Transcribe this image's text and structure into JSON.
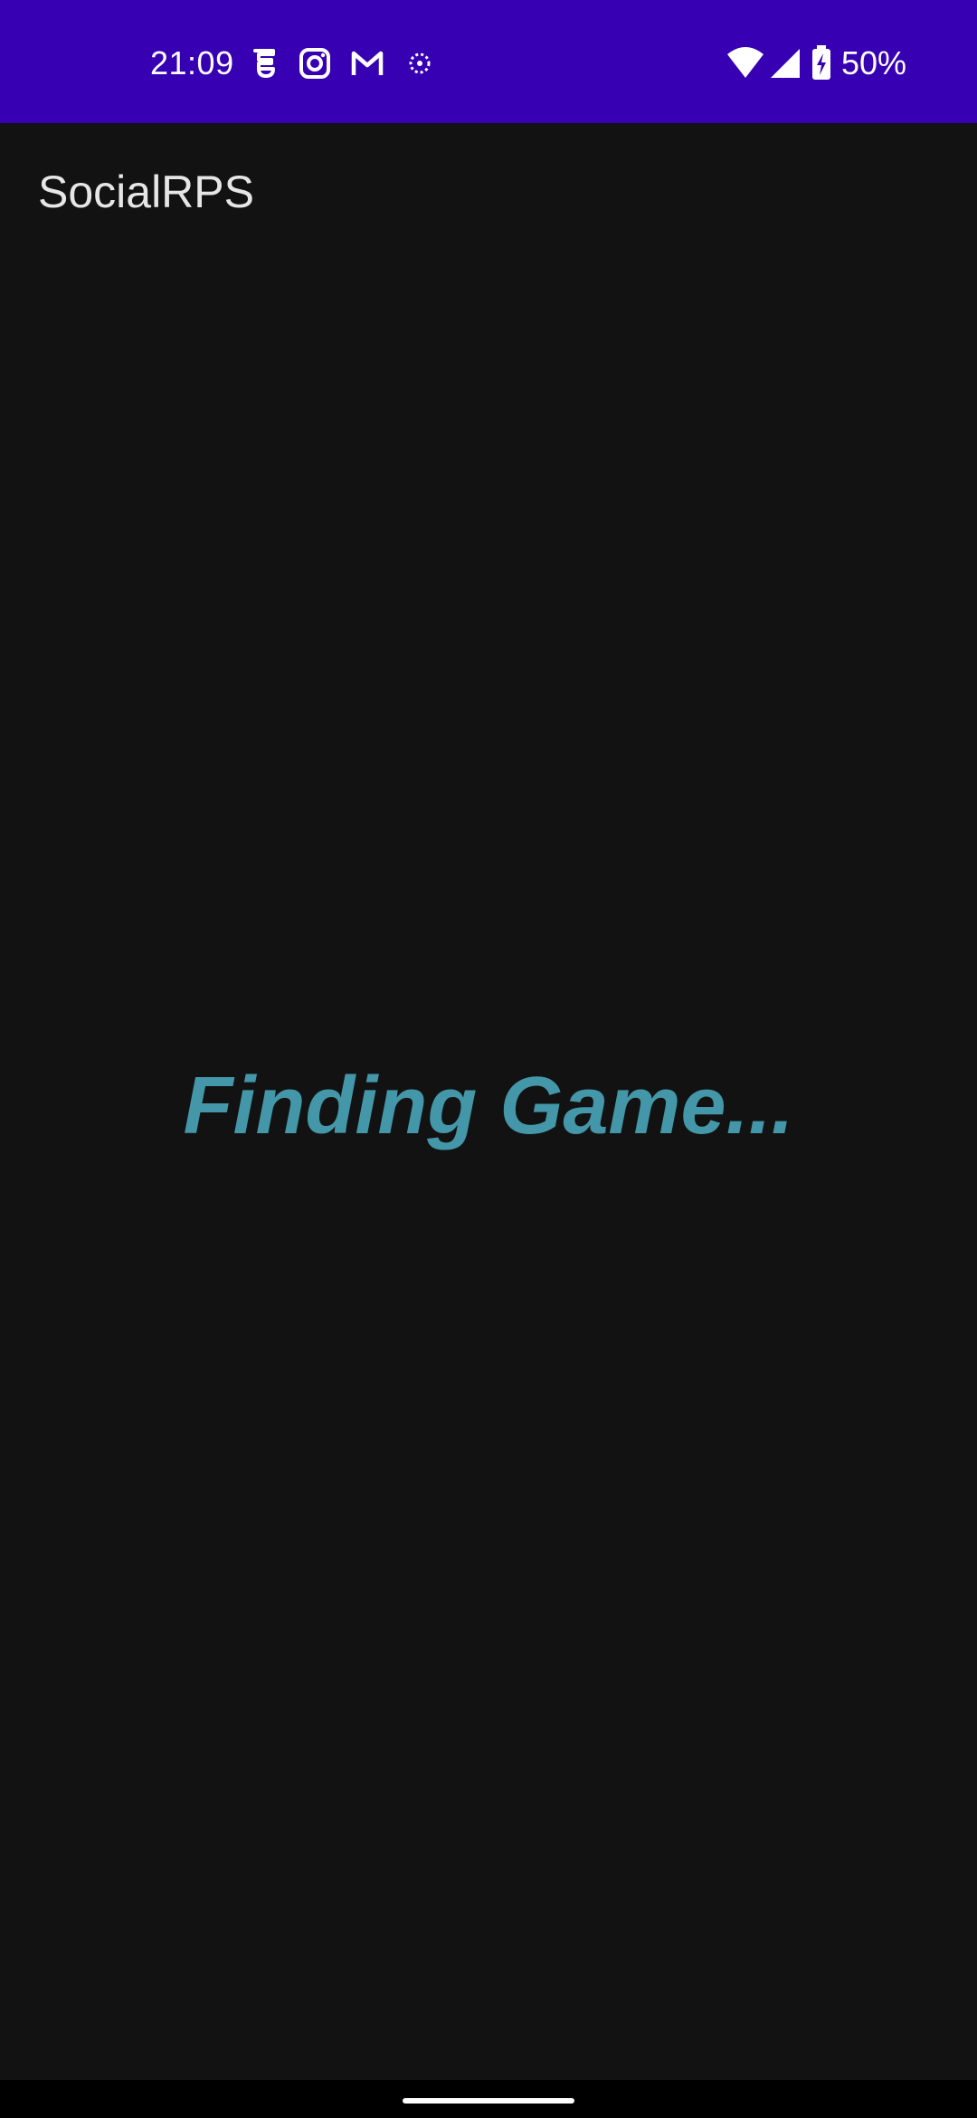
{
  "status_bar": {
    "time": "21:09",
    "battery": "50%",
    "background": "#3700B3",
    "notification_icons": [
      "chat-bubble-icon",
      "instagram-icon",
      "gmail-icon",
      "circle-dots-icon"
    ],
    "system_icons": [
      "wifi-icon",
      "signal-icon",
      "battery-charging-icon"
    ]
  },
  "app_bar": {
    "title": "SocialRPS"
  },
  "main": {
    "status_message": "Finding Game...",
    "accent_color": "#4397A8"
  },
  "theme": {
    "background": "#121212"
  }
}
